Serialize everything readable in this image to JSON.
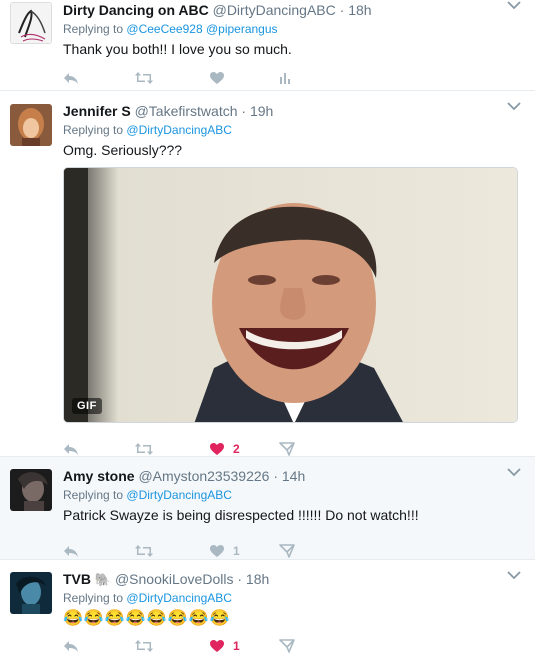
{
  "tweets": [
    {
      "fullname": "Dirty Dancing on ABC",
      "handle": "@DirtyDancingABC",
      "time": "18h",
      "replying_label": "Replying to",
      "mentions": [
        "@CeeCee928",
        "@piperangus"
      ],
      "text": "Thank you both!! I love you so much.",
      "avatar_icon": "dirty-dancing-logo",
      "like_count": "",
      "actions": [
        "reply-icon",
        "retweet-icon",
        "like-icon",
        "analytics-icon"
      ]
    },
    {
      "fullname": "Jennifer S",
      "handle": "@Takefirstwatch",
      "time": "19h",
      "replying_label": "Replying to",
      "mentions": [
        "@DirtyDancingABC"
      ],
      "text": "Omg.  Seriously???",
      "gif_label": "GIF",
      "like_count": "2",
      "actions": [
        "reply-icon",
        "retweet-icon",
        "like-icon",
        "message-icon"
      ]
    },
    {
      "fullname": "Amy stone",
      "handle": "@Amyston23539226",
      "time": "14h",
      "replying_label": "Replying to",
      "mentions": [
        "@DirtyDancingABC"
      ],
      "text": "Patrick Swayze is being disrespected !!!!!! Do not watch!!!",
      "like_count": "1",
      "actions": [
        "reply-icon",
        "retweet-icon",
        "like-icon",
        "message-icon"
      ]
    },
    {
      "fullname": "TVB",
      "name_emoji": "🐘",
      "handle": "@SnookiLoveDolls",
      "time": "18h",
      "replying_label": "Replying to",
      "mentions": [
        "@DirtyDancingABC"
      ],
      "text": "😂😂😂😂😂😂😂😂",
      "like_count": "1",
      "actions": [
        "reply-icon",
        "retweet-icon",
        "like-icon",
        "message-icon"
      ]
    }
  ],
  "dot": "·",
  "colors": {
    "link": "#1b95e0",
    "muted": "#657786",
    "like_active": "#e0245e",
    "icon": "#aab8c2"
  }
}
